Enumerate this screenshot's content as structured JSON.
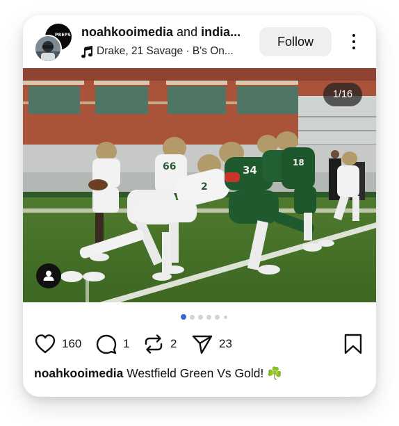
{
  "header": {
    "author": "noahkooimedia",
    "conjunction": "and",
    "coauthor_truncated": "india...",
    "avatar_back_text": "PREPS",
    "music": "Drake, 21 Savage · B's On...",
    "follow_label": "Follow"
  },
  "photo": {
    "counter": "1/16"
  },
  "carousel": {
    "total_dots": 6,
    "active_index": 0
  },
  "actions": {
    "likes": "160",
    "comments": "1",
    "reposts": "2",
    "shares": "23"
  },
  "caption": {
    "username": "noahkooimedia",
    "text": "Westfield Green Vs Gold! ☘️"
  },
  "colors": {
    "active_dot": "#3a68c9",
    "green_jersey": "#1f5a2e",
    "white_jersey": "#f2f2f2",
    "helmet_gold": "#b39a6a"
  },
  "icons": [
    "music-icon",
    "person-tag-icon",
    "heart-icon",
    "comment-icon",
    "repost-icon",
    "share-icon",
    "bookmark-icon",
    "more-icon"
  ]
}
